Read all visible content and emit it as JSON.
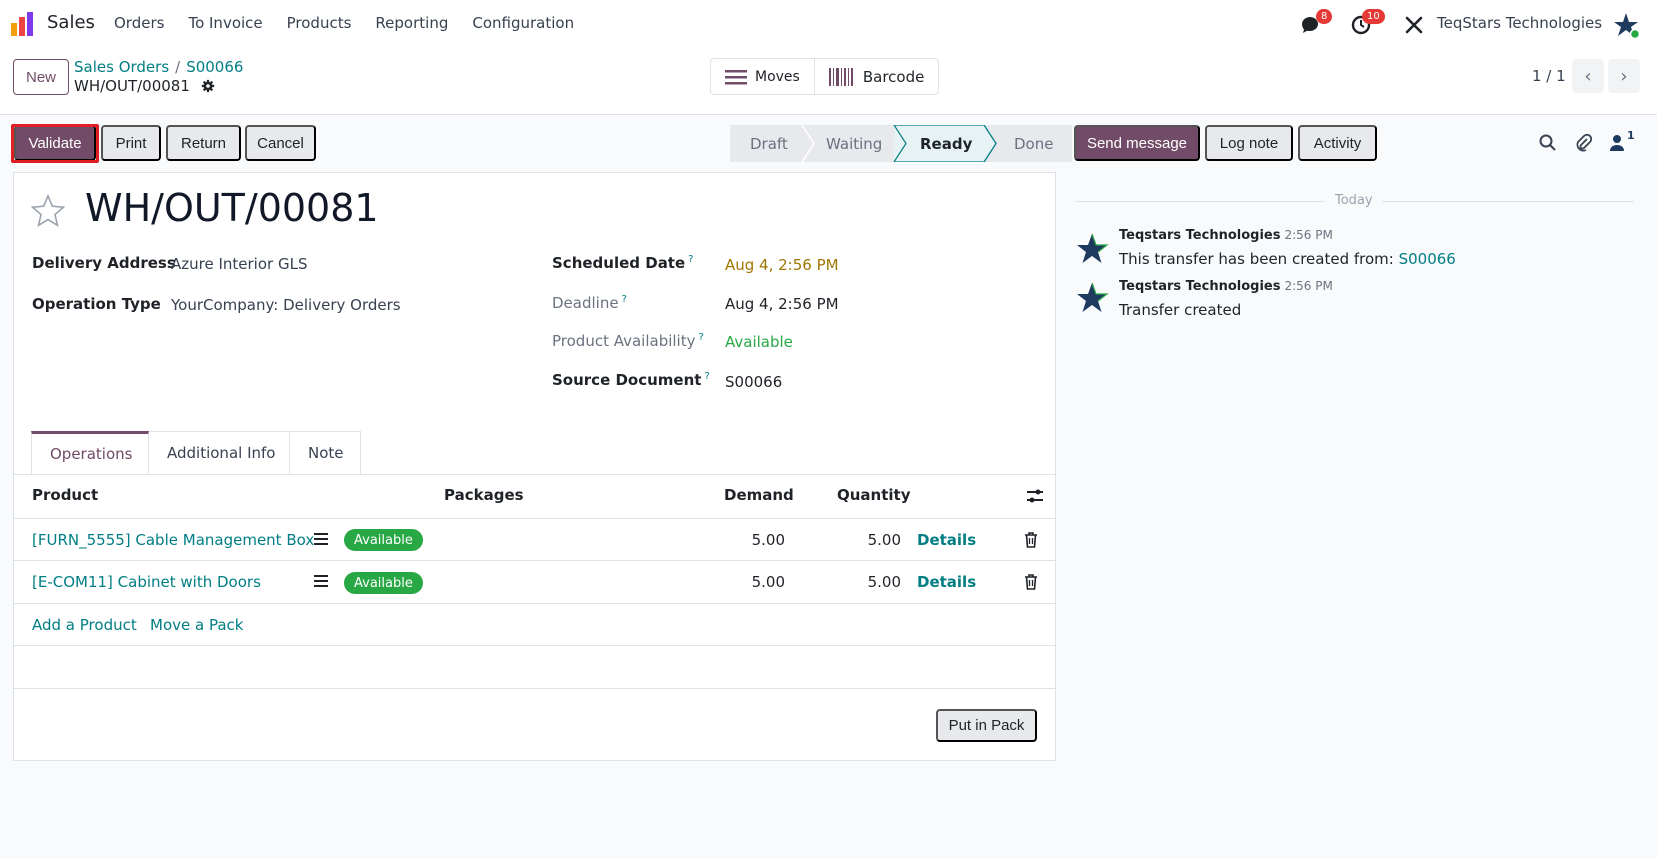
{
  "app": {
    "name": "Sales",
    "menu": [
      "Orders",
      "To Invoice",
      "Products",
      "Reporting",
      "Configuration"
    ],
    "messages_count": "8",
    "activities_count": "10",
    "company": "TeqStars Technologies"
  },
  "control": {
    "new_label": "New",
    "breadcrumb": [
      "Sales Orders",
      "S00066"
    ],
    "record_title": "WH/OUT/00081",
    "smart_buttons": [
      "Moves",
      "Barcode"
    ],
    "pager": "1 / 1"
  },
  "actions": [
    "Validate",
    "Print",
    "Return",
    "Cancel"
  ],
  "status": {
    "stages": [
      "Draft",
      "Waiting",
      "Ready",
      "Done"
    ],
    "active": "Ready"
  },
  "chatter_actions": [
    "Send message",
    "Log note",
    "Activity"
  ],
  "followers_count": "1",
  "form": {
    "title": "WH/OUT/00081",
    "fields_left": [
      {
        "label": "Delivery Address",
        "value": "Azure Interior GLS"
      },
      {
        "label": "Operation Type",
        "value": "YourCompany: Delivery Orders"
      }
    ],
    "scheduled_date": {
      "label": "Scheduled Date",
      "value": "Aug 4, 2:56 PM"
    },
    "deadline": {
      "label": "Deadline",
      "value": "Aug 4, 2:56 PM"
    },
    "availability": {
      "label": "Product Availability",
      "value": "Available"
    },
    "source": {
      "label": "Source Document",
      "value": "S00066"
    },
    "help_mark": "?"
  },
  "tabs": [
    "Operations",
    "Additional Info",
    "Note"
  ],
  "table": {
    "headers": [
      "Product",
      "Packages",
      "Demand",
      "Quantity"
    ],
    "rows": [
      {
        "product": "[FURN_5555] Cable Management Box",
        "status": "Available",
        "demand": "5.00",
        "quantity": "5.00",
        "details": "Details"
      },
      {
        "product": "[E-COM11] Cabinet with Doors",
        "status": "Available",
        "demand": "5.00",
        "quantity": "5.00",
        "details": "Details"
      }
    ],
    "add_product": "Add a Product",
    "move_pack": "Move a Pack",
    "put_in_pack": "Put in Pack"
  },
  "chatter": {
    "date_sep": "Today",
    "messages": [
      {
        "author": "Teqstars Technologies",
        "time": "2:56 PM",
        "body": "This transfer has been created from:",
        "link": "S00066"
      },
      {
        "author": "Teqstars Technologies",
        "time": "2:56 PM",
        "body": "Transfer created",
        "link": ""
      }
    ]
  },
  "colors": {
    "brand": "#714b67",
    "link": "#017e84",
    "available": "#28a745",
    "highlight": "#e21d24",
    "warning_date": "#a07600"
  }
}
